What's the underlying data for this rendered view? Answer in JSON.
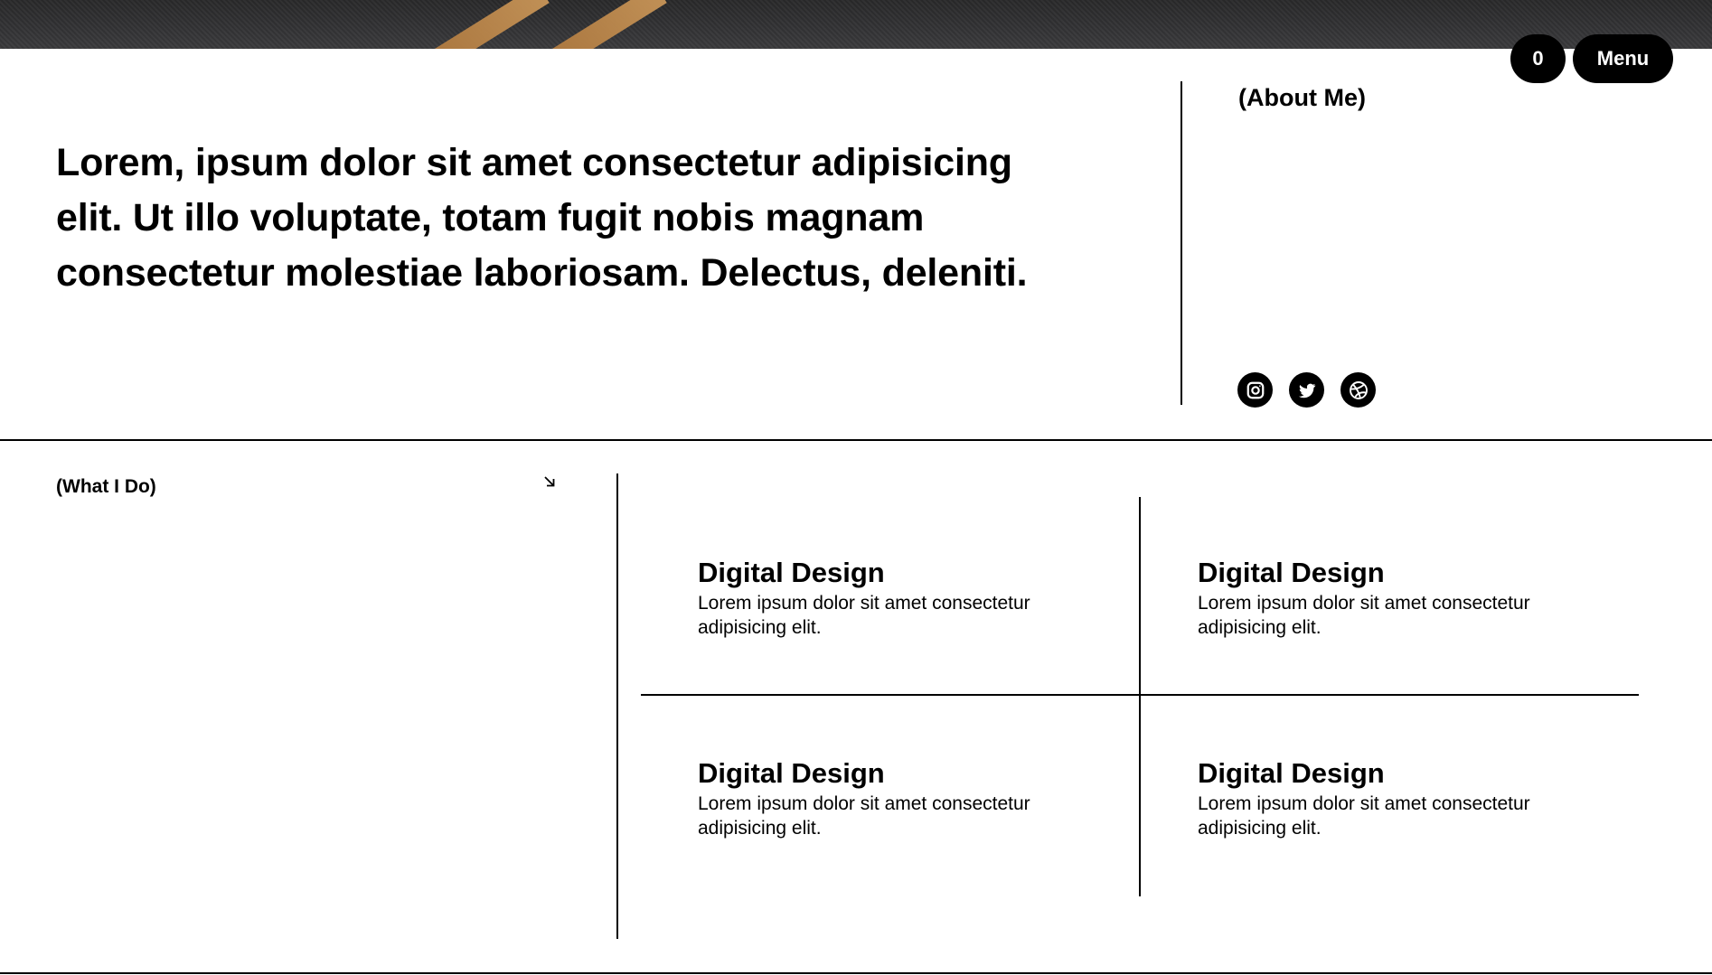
{
  "header": {
    "cart_count": "0",
    "menu_label": "Menu"
  },
  "intro": {
    "text": "Lorem, ipsum dolor sit amet consectetur adipisicing elit. Ut illo voluptate, totam fugit nobis magnam consectetur molestiae laboriosam. Delectus, deleniti.",
    "about_label": "(About Me)",
    "social_icons": [
      "instagram-icon",
      "twitter-icon",
      "dribbble-icon"
    ]
  },
  "what_i_do": {
    "label": "(What I Do)",
    "arrow_icon": "arrow-down-right-icon",
    "services": [
      {
        "title": "Digital Design",
        "description": "Lorem ipsum dolor sit amet consectetur adipisicing elit."
      },
      {
        "title": "Digital Design",
        "description": "Lorem ipsum dolor sit amet consectetur adipisicing elit."
      },
      {
        "title": "Digital Design",
        "description": "Lorem ipsum dolor sit amet consectetur adipisicing elit."
      },
      {
        "title": "Digital Design",
        "description": "Lorem ipsum dolor sit amet consectetur adipisicing elit."
      }
    ]
  },
  "colors": {
    "text": "#000000",
    "background": "#ffffff",
    "button_bg": "#000000",
    "button_text": "#ffffff",
    "banner_dark": "#333335",
    "banner_stripe": "#c89558"
  }
}
